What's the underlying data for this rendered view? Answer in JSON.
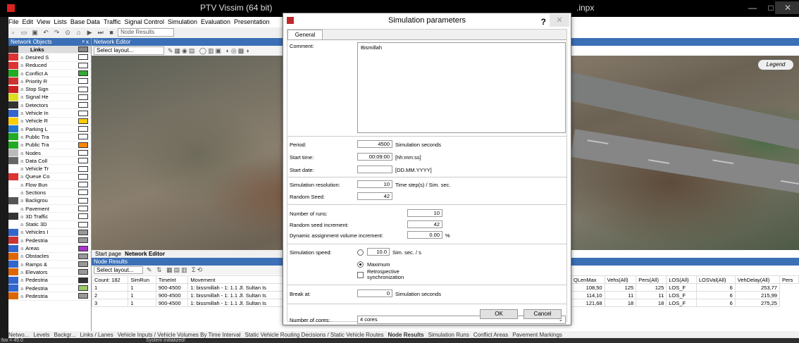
{
  "window": {
    "title": "PTV Vissim (64 bit)",
    "title_right": ".inpx",
    "minimize": "—",
    "maximize": "□",
    "close": "✕"
  },
  "menu": [
    "File",
    "Edit",
    "View",
    "Lists",
    "Base Data",
    "Traffic",
    "Signal Control",
    "Simulation",
    "Evaluation",
    "Presentation"
  ],
  "toolbar": {
    "combo_value": "Node Results"
  },
  "network_objects": {
    "title": "Network Objects",
    "pin": "ᵖ x",
    "header_label": "Links",
    "items": [
      {
        "label": "Desired S",
        "icon_color": "#d33",
        "swatch": "#fff"
      },
      {
        "label": "Reduced",
        "icon_color": "#d33",
        "swatch": "#fff"
      },
      {
        "label": "Conflict A",
        "icon_color": "#2a2",
        "swatch": "#3a3"
      },
      {
        "label": "Priority R",
        "icon_color": "#c33",
        "swatch": "#fff"
      },
      {
        "label": "Stop Sign",
        "icon_color": "#c22",
        "swatch": "#fff"
      },
      {
        "label": "Signal He",
        "icon_color": "#dd2",
        "swatch": "#fff"
      },
      {
        "label": "Detectors",
        "icon_color": "#333",
        "swatch": "#fff"
      },
      {
        "label": "Vehicle In",
        "icon_color": "#36c",
        "swatch": "#fff"
      },
      {
        "label": "Vehicle R",
        "icon_color": "#fc0",
        "swatch": "#fc0"
      },
      {
        "label": "Parking L",
        "icon_color": "#27c",
        "swatch": "#fff"
      },
      {
        "label": "Public Tra",
        "icon_color": "#2a2",
        "swatch": "#fff"
      },
      {
        "label": "Public Tra",
        "icon_color": "#2a2",
        "swatch": "#f80"
      },
      {
        "label": "Nodes",
        "icon_color": "#bbb",
        "swatch": "#fff"
      },
      {
        "label": "Data Coll",
        "icon_color": "#666",
        "swatch": "#fff"
      },
      {
        "label": "Vehicle Tr",
        "icon_color": "#fff",
        "swatch": "#fff"
      },
      {
        "label": "Queue Co",
        "icon_color": "#d33",
        "swatch": "#fff"
      },
      {
        "label": "Flow Bun",
        "icon_color": "#fff",
        "swatch": "#fff"
      },
      {
        "label": "Sections",
        "icon_color": "#fff",
        "swatch": "#fff"
      },
      {
        "label": "Backgrou",
        "icon_color": "#555",
        "swatch": "#fff"
      },
      {
        "label": "Pavement",
        "icon_color": "#fff",
        "swatch": "#fff"
      },
      {
        "label": "3D Traffic",
        "icon_color": "#333",
        "swatch": "#fff"
      },
      {
        "label": "Static 3D",
        "icon_color": "#fff",
        "swatch": "#fff"
      },
      {
        "label": "Vehicles I",
        "icon_color": "#36c",
        "swatch": "#999"
      },
      {
        "label": "Pedestria",
        "icon_color": "#c33",
        "swatch": "#999"
      },
      {
        "label": "Areas",
        "icon_color": "#36c",
        "swatch": "#a3c"
      },
      {
        "label": "Obstacles",
        "icon_color": "#d60",
        "swatch": "#999"
      },
      {
        "label": "Ramps &",
        "icon_color": "#36c",
        "swatch": "#999"
      },
      {
        "label": "Elevators",
        "icon_color": "#d60",
        "swatch": "#999"
      },
      {
        "label": "Pedestria",
        "icon_color": "#36c",
        "swatch": "#333"
      },
      {
        "label": "Pedestria",
        "icon_color": "#36c",
        "swatch": "#9c6"
      },
      {
        "label": "Pedestria",
        "icon_color": "#d60",
        "swatch": "#999"
      }
    ]
  },
  "network_editor": {
    "title": "Network Editor",
    "layout_placeholder": "Select layout...",
    "legend_label": "Legend",
    "tabs": [
      "Start page",
      "Network Editor"
    ]
  },
  "node_results": {
    "title": "Node Results",
    "layout_placeholder": "Select layout...",
    "left_columns": [
      "Count: 182",
      "SimRun",
      "TimeInt",
      "Movement"
    ],
    "left_rows": [
      [
        "1",
        "1",
        "900-4500",
        "1: bissmillah - 1: 1.1 Jl. Sultan Is"
      ],
      [
        "2",
        "1",
        "900-4500",
        "1: bissmillah - 1: 1.1 Jl. Sultan Is"
      ],
      [
        "3",
        "1",
        "900-4500",
        "1: bissmillah - 1: 1.1 Jl. Sultan Is"
      ]
    ],
    "right_columns": [
      "QLenMax",
      "Vehs(All)",
      "Pers(All)",
      "LOS(All)",
      "LOSVal(All)",
      "VehDelay(All)",
      "Pers"
    ],
    "right_rows": [
      [
        "108,50",
        "125",
        "125",
        "LOS_F",
        "6",
        "253,77"
      ],
      [
        "114,10",
        "11",
        "11",
        "LOS_F",
        "6",
        "215,99"
      ],
      [
        "121,68",
        "18",
        "18",
        "LOS_F",
        "6",
        "275,25"
      ]
    ]
  },
  "bottom_tabs": [
    "Netwo...",
    "Levels",
    "Backgr...",
    "Links / Lanes",
    "Vehicle Inputs / Vehicle Volumes By Time Interval",
    "Static Vehicle Routing Decisions / Static Vehicle Routes",
    "Node Results",
    "Simulation Runs",
    "Conflict Areas",
    "Pavement Markings"
  ],
  "status": {
    "fov": "fov = 45.0",
    "message": "System initialized!"
  },
  "dialog": {
    "title": "Simulation parameters",
    "help": "?",
    "close": "✕",
    "tab": "General",
    "comment_label": "Comment:",
    "comment_value": "Bismillah",
    "period_label": "Period:",
    "period_value": "4500",
    "period_unit": "Simulation seconds",
    "start_time_label": "Start time:",
    "start_time_value": "00:09:00",
    "start_time_format": "[hh:mm:ss]",
    "start_date_label": "Start date:",
    "start_date_value": "",
    "start_date_format": "[DD.MM.YYYY]",
    "resolution_label": "Simulation resolution:",
    "resolution_value": "10",
    "resolution_unit": "Time step(s) / Sim. sec.",
    "seed_label": "Random Seed:",
    "seed_value": "42",
    "runs_label": "Number of runs:",
    "runs_value": "10",
    "seed_inc_label": "Random seed increment:",
    "seed_inc_value": "42",
    "dyn_label": "Dynamic assignment volume increment:",
    "dyn_value": "0.00",
    "dyn_unit": "%",
    "speed_label": "Simulation speed:",
    "speed_value": "10.0",
    "speed_unit": "Sim. sec. / s",
    "maximum_label": "Maximum",
    "retro_label": "Retrospective synchronization",
    "break_label": "Break at:",
    "break_value": "0",
    "break_unit": "Simulation seconds",
    "cores_label": "Number of cores:",
    "cores_value": "4 cores",
    "ok": "OK",
    "cancel": "Cancel"
  }
}
